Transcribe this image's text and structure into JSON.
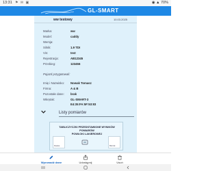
{
  "status_bar": {
    "time": "13:31",
    "icons": "⚑ ✉ ▣",
    "right": "◉ ▲ 70%"
  },
  "app": {
    "logo_text": "GL-SMART"
  },
  "document": {
    "title": "ww testowy",
    "date": "10.03.2025"
  },
  "fields": [
    {
      "label": "Marka:",
      "value": "ww"
    },
    {
      "label": "Model:",
      "value": "caddy"
    },
    {
      "label": "Wersja:",
      "value": ""
    },
    {
      "label": "Silnik:",
      "value": "1.9 TDI"
    },
    {
      "label": "Vin:",
      "value": "test"
    },
    {
      "label": "Rejestracja:",
      "value": "AB12345"
    },
    {
      "label": "Przebieg:",
      "value": "123456"
    }
  ],
  "section_title": "Pojazd przygotowali:",
  "people": [
    {
      "label": "Imię i Nazwisko:",
      "value": "Nowak Tomasz"
    },
    {
      "label": "Firma:",
      "value": "A & B"
    },
    {
      "label": "Pozostałe dane:",
      "value": "brak"
    },
    {
      "label": "Wkrętak:",
      "value": "GL-SMART-3"
    },
    {
      "label": "",
      "value": "E4:35:FA:5F:53:83"
    }
  ],
  "list": {
    "title": "Listy pomiarów",
    "card_title_line1": "TABLICZYCZKI PRZEDSTAWIONE WYNIKÓW POMIARÓW",
    "card_title_line2": "POWŁOKI LAKIEROWEJ",
    "slot_left": "Maska",
    "slot_right": "Błotnik"
  },
  "nav": [
    {
      "label": "Wprowadź dane",
      "icon": "pencil-icon"
    },
    {
      "label": "Udostępnij",
      "icon": "share-icon"
    },
    {
      "label": "Usuń",
      "icon": "trash-icon"
    }
  ],
  "colors": {
    "header": "#1e88e5",
    "content_bg": "#dff1fb",
    "active_nav": "#1565c0"
  }
}
